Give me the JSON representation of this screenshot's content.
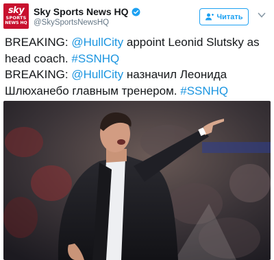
{
  "account": {
    "avatar_line1": "sky",
    "avatar_line2": "SPORTS",
    "avatar_line3": "NEWS HQ",
    "display_name": "Sky Sports News HQ",
    "handle": "@SkySportsNewsHQ",
    "verified_icon": "verified-badge-icon"
  },
  "follow_button": {
    "label": "Читать",
    "icon": "add-user-icon"
  },
  "menu_icon": "chevron-down-icon",
  "tweet": {
    "line1_pre": "BREAKING: ",
    "line1_mention": "@HullCity",
    "line1_mid": " appoint Leonid Slutsky as head coach. ",
    "line1_tag": "#SSNHQ",
    "line2_pre": "BREAKING: ",
    "line2_mention": "@HullCity",
    "line2_mid": " назначил Леонида Шлюханебо главным тренером. ",
    "line2_tag": "#SSNHQ"
  },
  "colors": {
    "brand_red": "#c8102e",
    "link_blue": "#1b95e0",
    "verified_blue": "#1da1f2"
  }
}
